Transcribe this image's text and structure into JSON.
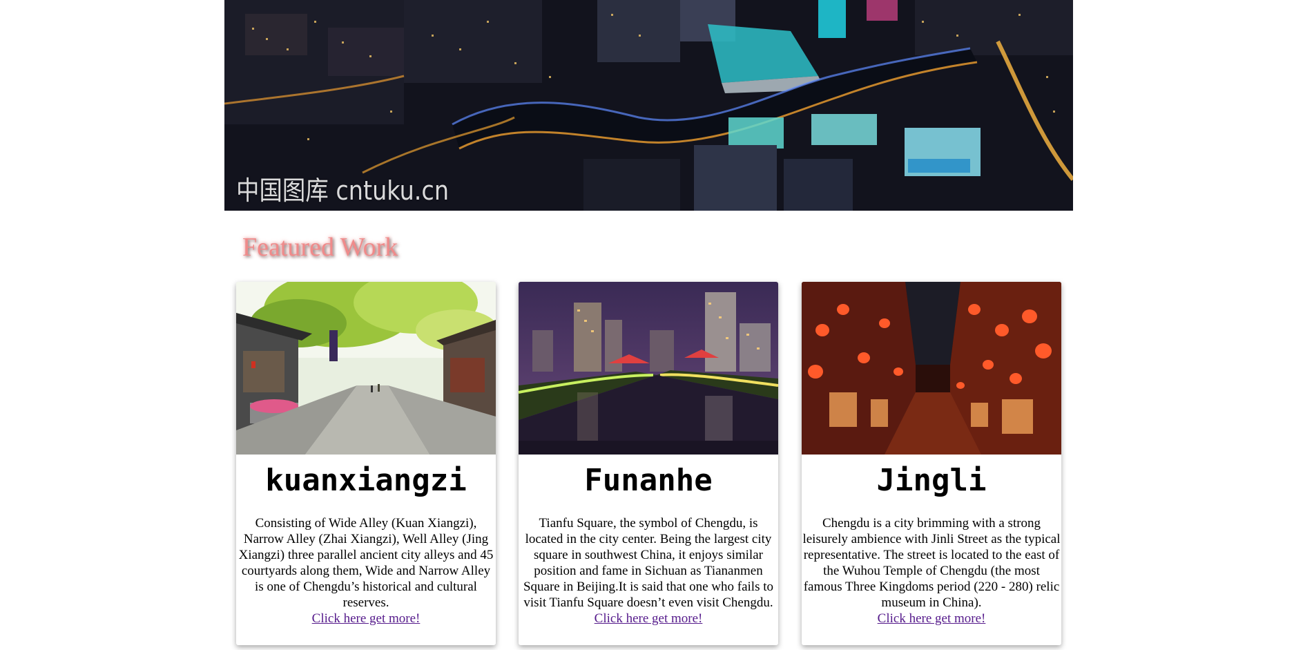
{
  "hero": {
    "watermark": "中国图库 cntuku.cn"
  },
  "section": {
    "title": "Featured Work"
  },
  "cards": [
    {
      "title": "kuanxiangzi",
      "text": "Consisting of Wide Alley (Kuan Xiangzi), Narrow Alley (Zhai Xiangzi), Well Alley (Jing Xiangzi) three parallel ancient city alleys and 45 courtyards along them, Wide and Narrow Alley is one of Chengdu’s historical and cultural reserves.",
      "link": "Click here get more!"
    },
    {
      "title": "Funanhe",
      "text": "Tianfu Square, the symbol of Chengdu, is located in the city center. Being the largest city square in southwest China, it enjoys similar position and fame in Sichuan as Tiananmen Square in Beijing.It is said that one who fails to visit Tianfu Square doesn’t even visit Chengdu.",
      "link": "Click here get more!"
    },
    {
      "title": "Jingli",
      "text": "Chengdu is a city brimming with a strong leisurely ambience with Jinli Street as the typical representative. The street is located to the east of the Wuhou Temple of Chengdu (the most famous Three Kingdoms period (220 - 280) relic museum in China).",
      "link": "Click here get more!"
    }
  ],
  "colors": {
    "link": "#551a8b",
    "title_accent": "#f08a8a"
  }
}
